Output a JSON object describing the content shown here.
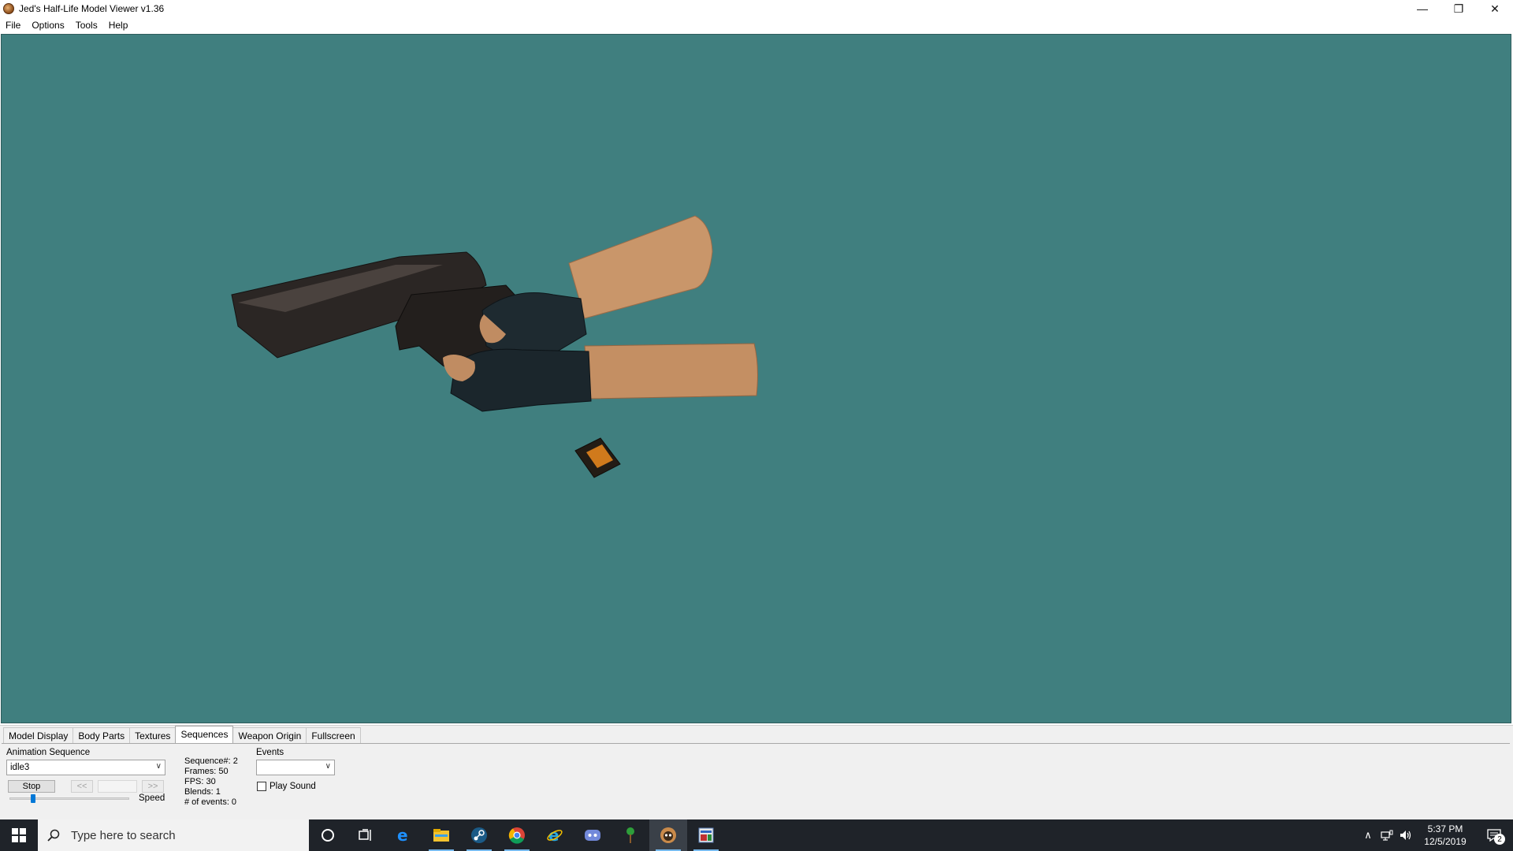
{
  "window": {
    "title": "Jed's Half-Life Model Viewer v1.36",
    "controls": {
      "minimize": "—",
      "restore": "❐",
      "close": "✕"
    }
  },
  "menu": [
    "File",
    "Options",
    "Tools",
    "Help"
  ],
  "viewport": {
    "background": "#407f7f"
  },
  "tabs": [
    "Model Display",
    "Body Parts",
    "Textures",
    "Sequences",
    "Weapon Origin",
    "Fullscreen"
  ],
  "active_tab": "Sequences",
  "sequences": {
    "animation_label": "Animation Sequence",
    "animation_value": "idle3",
    "stop_label": "Stop",
    "prev_label": "<<",
    "next_label": ">>",
    "speed_label": "Speed",
    "speed_level": 0.2,
    "info": [
      "Sequence#: 2",
      "Frames: 50",
      "FPS: 30",
      "Blends: 1",
      "# of events: 0"
    ],
    "events_label": "Events",
    "events_value": "",
    "play_sound_label": "Play Sound"
  },
  "taskbar": {
    "search_placeholder": "Type here to search",
    "icons": [
      "cortana-icon",
      "task-view-icon",
      "edge-icon",
      "file-explorer-icon",
      "steam-icon",
      "chrome-icon",
      "internet-explorer-icon",
      "discord-icon",
      "tree-app-icon",
      "hlmv-icon",
      "control-panel-icon"
    ],
    "time": "5:37 PM",
    "date": "12/5/2019",
    "notifications": "2"
  }
}
